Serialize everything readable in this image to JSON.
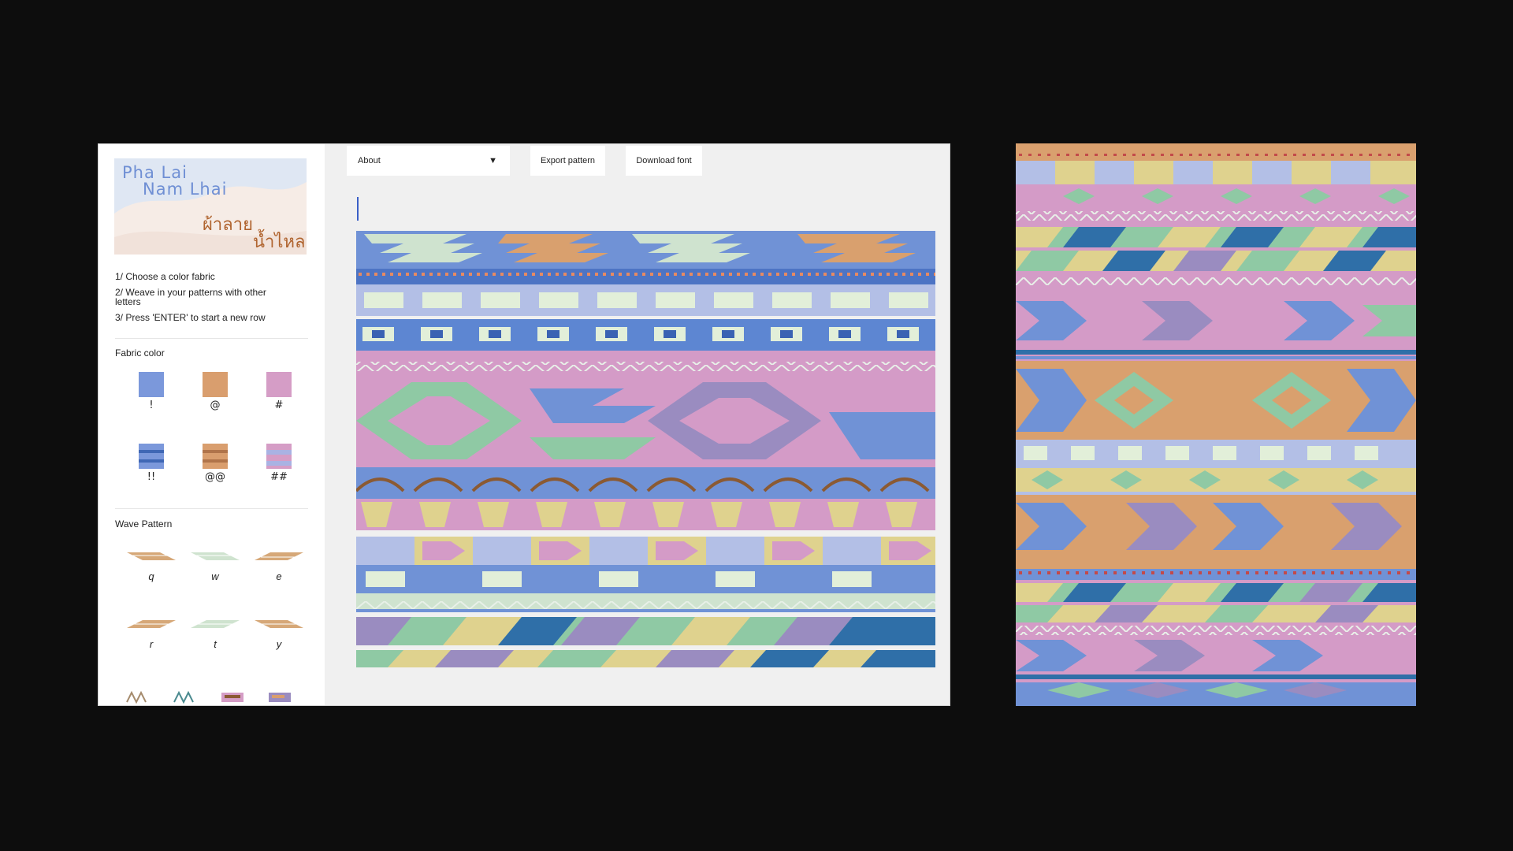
{
  "logo": {
    "title_en_line1": "Pha Lai",
    "title_en_line2": "Nam Lhai",
    "title_th_line1": "ผ้าลาย",
    "title_th_line2": "น้ำไหล"
  },
  "instructions": [
    "1/ Choose a color fabric",
    "2/ Weave in your patterns with other letters",
    "3/ Press 'ENTER' to start a new row"
  ],
  "fabric": {
    "title": "Fabric color",
    "swatches": [
      {
        "label": "!",
        "color": "#7b98db",
        "style": "solid"
      },
      {
        "label": "@",
        "color": "#d99e6e",
        "style": "solid"
      },
      {
        "label": "#",
        "color": "#d59dc6",
        "style": "solid"
      },
      {
        "label": "!!",
        "color": "#7b98db",
        "style": "striped"
      },
      {
        "label": "@@",
        "color": "#d99e6e",
        "style": "striped"
      },
      {
        "label": "##",
        "color": "#d59dc6",
        "style": "striped"
      }
    ]
  },
  "wave": {
    "title": "Wave Pattern",
    "items": [
      {
        "label": "q",
        "color": "#d6a878"
      },
      {
        "label": "w",
        "color": "#cfe3cf"
      },
      {
        "label": "e",
        "color": "#d6a878"
      },
      {
        "label": "r",
        "color": "#d6a878"
      },
      {
        "label": "t",
        "color": "#cfe3cf"
      },
      {
        "label": "y",
        "color": "#d6a878"
      }
    ]
  },
  "toolbar": {
    "about_label": "About",
    "about_arrow": "▼",
    "export_label": "Export pattern",
    "download_label": "Download font"
  },
  "colors": {
    "blue": "#7092d6",
    "orange": "#d9a06e",
    "pink": "#d49bc7",
    "mint": "#cfe3cf",
    "lavender": "#b3bfe6",
    "green": "#8fc9a4",
    "yellow": "#dfd28e",
    "purple": "#9a8cc0",
    "darkblue": "#2f6fa8",
    "brown": "#8b5a33"
  }
}
